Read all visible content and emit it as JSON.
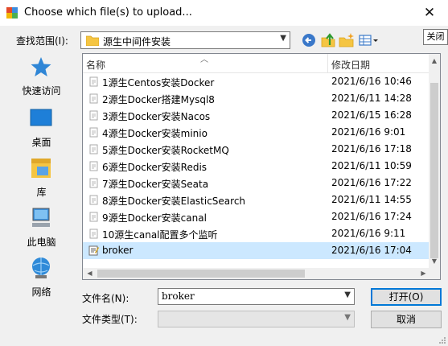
{
  "window": {
    "title": "Choose which file(s) to upload...",
    "close_glyph": "✕",
    "close_tooltip": "关闭"
  },
  "lookin": {
    "label": "查找范围(I):",
    "value": "源生中间件安装",
    "toolbar_icons": [
      "back-arrow-icon",
      "up-folder-icon",
      "new-folder-icon",
      "view-menu-icon"
    ]
  },
  "places": [
    {
      "label": "快速访问",
      "icon": "star-icon"
    },
    {
      "label": "桌面",
      "icon": "desktop-icon"
    },
    {
      "label": "库",
      "icon": "library-icon"
    },
    {
      "label": "此电脑",
      "icon": "computer-icon"
    },
    {
      "label": "网络",
      "icon": "network-icon"
    }
  ],
  "list": {
    "columns": {
      "name": "名称",
      "date": "修改日期"
    },
    "rows": [
      {
        "name": "1源生Centos安装Docker",
        "date": "2021/6/16 10:46",
        "type": "doc"
      },
      {
        "name": "2源生Docker搭建Mysql8",
        "date": "2021/6/11 14:28",
        "type": "doc"
      },
      {
        "name": "3源生Docker安装Nacos",
        "date": "2021/6/15 16:28",
        "type": "doc"
      },
      {
        "name": "4源生Docker安装minio",
        "date": "2021/6/16 9:01",
        "type": "doc"
      },
      {
        "name": "5源生Docker安装RocketMQ",
        "date": "2021/6/16 17:18",
        "type": "doc"
      },
      {
        "name": "6源生Docker安装Redis",
        "date": "2021/6/11 10:59",
        "type": "doc"
      },
      {
        "name": "7源生Docker安装Seata",
        "date": "2021/6/16 17:22",
        "type": "doc"
      },
      {
        "name": "8源生Docker安装ElasticSearch",
        "date": "2021/6/11 14:55",
        "type": "doc"
      },
      {
        "name": "9源生Docker安装canal",
        "date": "2021/6/16 17:24",
        "type": "doc"
      },
      {
        "name": "10源生canal配置多个监听",
        "date": "2021/6/16 9:11",
        "type": "doc"
      },
      {
        "name": "broker",
        "date": "2021/6/16 17:04",
        "type": "text",
        "selected": true
      }
    ]
  },
  "filename": {
    "label": "文件名(N):",
    "value": "broker"
  },
  "filetype": {
    "label": "文件类型(T):",
    "value": ""
  },
  "buttons": {
    "open": "打开(O)",
    "cancel": "取消"
  },
  "colors": {
    "selection": "#cce8ff",
    "accent": "#0078d7"
  }
}
